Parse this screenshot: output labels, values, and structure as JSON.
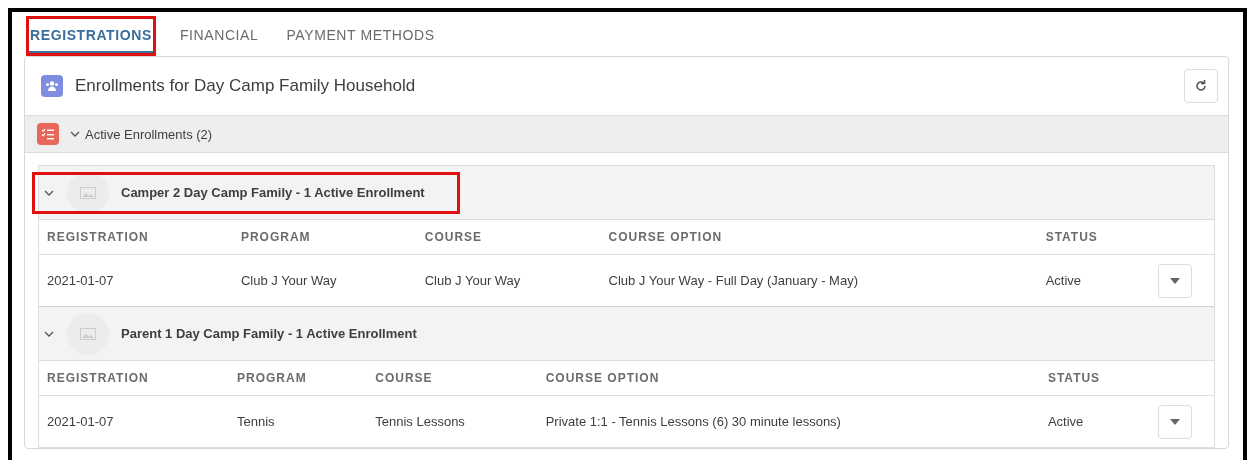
{
  "tabs": [
    {
      "label": "REGISTRATIONS",
      "selected": true,
      "highlighted": true
    },
    {
      "label": "FINANCIAL",
      "selected": false,
      "highlighted": false
    },
    {
      "label": "PAYMENT METHODS",
      "selected": false,
      "highlighted": false
    }
  ],
  "card": {
    "title": "Enrollments for Day Camp Family Household",
    "section": {
      "label": "Active Enrollments (2)",
      "expanded": true,
      "groups": [
        {
          "title": "Camper 2 Day Camp Family - 1 Active Enrollment",
          "expanded": true,
          "highlighted": true,
          "columns": [
            "REGISTRATION",
            "PROGRAM",
            "COURSE",
            "COURSE OPTION",
            "STATUS"
          ],
          "rows": [
            [
              "2021-01-07",
              "Club J Your Way",
              "Club J Your Way",
              "Club J Your Way - Full Day (January - May)",
              "Active"
            ]
          ]
        },
        {
          "title": "Parent 1 Day Camp Family - 1 Active Enrollment",
          "expanded": true,
          "highlighted": false,
          "columns": [
            "REGISTRATION",
            "PROGRAM",
            "COURSE",
            "COURSE OPTION",
            "STATUS"
          ],
          "rows": [
            [
              "2021-01-07",
              "Tennis",
              "Tennis Lessons",
              "Private 1:1 - Tennis Lessons (6) 30 minute lessons)",
              "Active"
            ]
          ]
        }
      ]
    }
  }
}
